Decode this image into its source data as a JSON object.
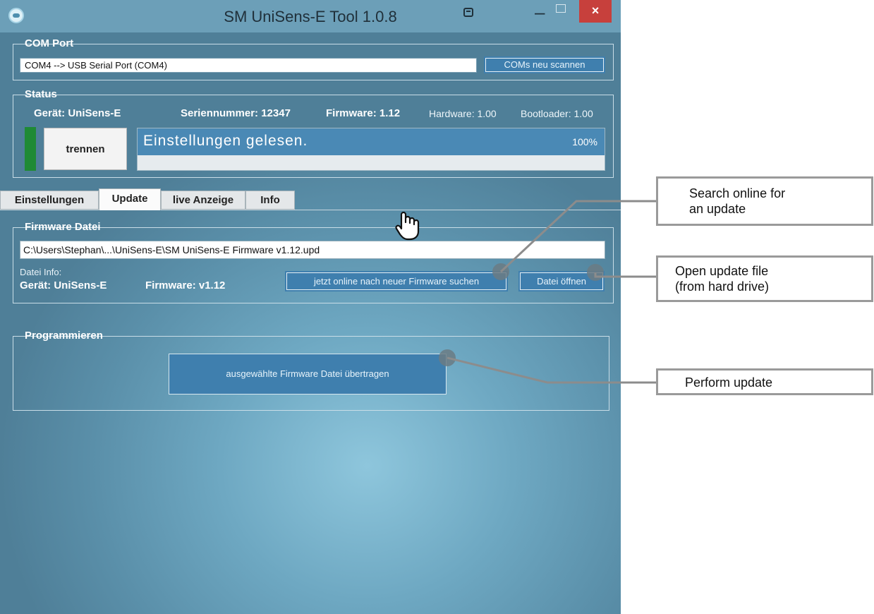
{
  "window": {
    "title": "SM UniSens-E Tool 1.0.8",
    "close_glyph": "×",
    "min_glyph": "–"
  },
  "com_port": {
    "group_title": "COM Port",
    "selected": "COM4 --> USB Serial Port (COM4)",
    "scan_button": "COMs neu scannen"
  },
  "status": {
    "group_title": "Status",
    "device": "Gerät: UniSens-E",
    "serial": "Seriennummer: 12347",
    "firmware": "Firmware: 1.12",
    "hardware": "Hardware: 1.00",
    "bootloader": "Bootloader: 1.00",
    "disconnect_button": "trennen",
    "progress_text": "Einstellungen gelesen.",
    "progress_label": "100%",
    "progress_fraction": 1.0,
    "connection_color": "#1f8a35"
  },
  "tabs": [
    {
      "label": "Einstellungen",
      "active": false
    },
    {
      "label": "Update",
      "active": true
    },
    {
      "label": "live Anzeige",
      "active": false
    },
    {
      "label": "Info",
      "active": false
    }
  ],
  "firmware_file": {
    "group_title": "Firmware Datei",
    "path": "C:\\Users\\Stephan\\...\\UniSens-E\\SM UniSens-E Firmware v1.12.upd",
    "info_label": "Datei Info:",
    "info_device": "Gerät: UniSens-E",
    "info_firmware": "Firmware: v1.12",
    "search_button": "jetzt online nach neuer Firmware suchen",
    "open_button": "Datei öffnen"
  },
  "programming": {
    "group_title": "Programmieren",
    "transfer_button": "ausgewählte Firmware Datei übertragen"
  },
  "callouts": {
    "search": [
      "Search online for",
      "an update"
    ],
    "open": [
      "Open update file",
      "(from hard drive)"
    ],
    "perform": [
      "Perform update"
    ]
  },
  "icons": {
    "cursor": "hand-pointer-icon",
    "app": "app-icon",
    "dropdown": "chevron-down-icon"
  },
  "colors": {
    "accent": "#3f7fae",
    "close": "#c7403c"
  }
}
